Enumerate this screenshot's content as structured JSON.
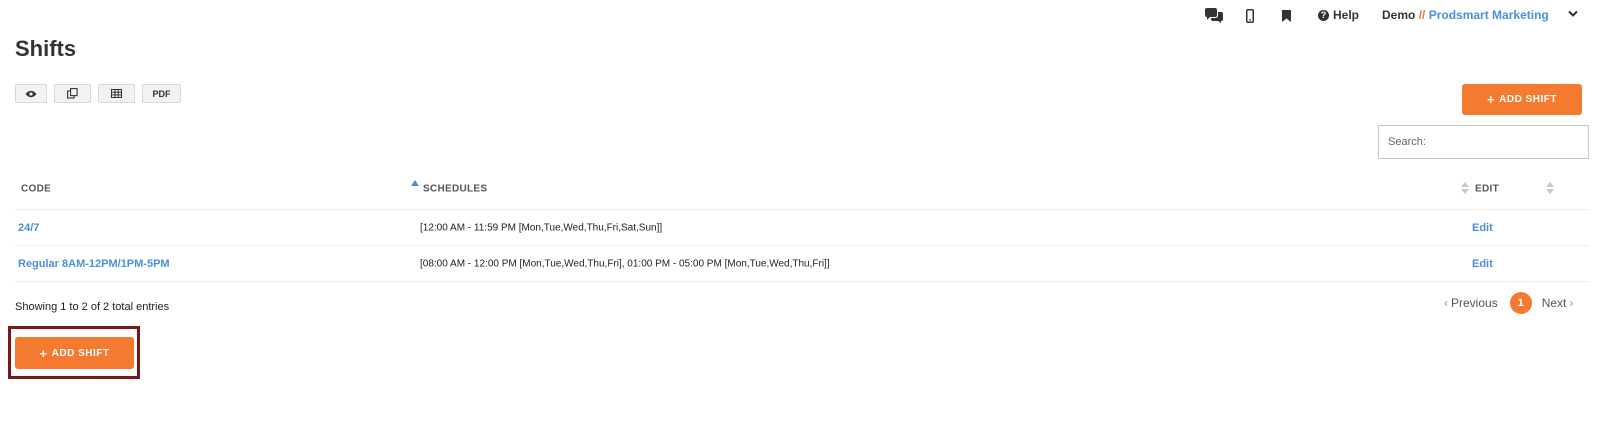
{
  "topnav": {
    "icons": [
      "chat-icon",
      "mobile-icon",
      "bookmark-icon"
    ],
    "help_label": "Help",
    "account_user": "Demo",
    "account_separator": "//",
    "account_org": "Prodsmart Marketing"
  },
  "page": {
    "title": "Shifts"
  },
  "tools": {
    "pdf_label": "PDF",
    "icons": [
      "eye-icon",
      "copy-icon",
      "table-icon"
    ]
  },
  "actions": {
    "add_shift_label": "ADD SHIFT"
  },
  "search": {
    "placeholder": "Search:"
  },
  "table": {
    "headers": {
      "code": "CODE",
      "schedules": "SCHEDULES",
      "edit": "EDIT"
    },
    "rows": [
      {
        "code": "24/7",
        "schedules": "[12:00 AM - 11:59 PM [Mon,Tue,Wed,Thu,Fri,Sat,Sun]]",
        "edit": "Edit"
      },
      {
        "code": "Regular 8AM-12PM/1PM-5PM",
        "schedules": "[08:00 AM - 12:00 PM [Mon,Tue,Wed,Thu,Fri], 01:00 PM - 05:00 PM [Mon,Tue,Wed,Thu,Fri]]",
        "edit": "Edit"
      }
    ]
  },
  "pagination": {
    "info": "Showing 1 to 2 of 2 total entries",
    "previous": "Previous",
    "current_page": "1",
    "next": "Next"
  },
  "colors": {
    "accent": "#f47a30",
    "link": "#4a90d9",
    "highlight_border": "#7b1616"
  }
}
